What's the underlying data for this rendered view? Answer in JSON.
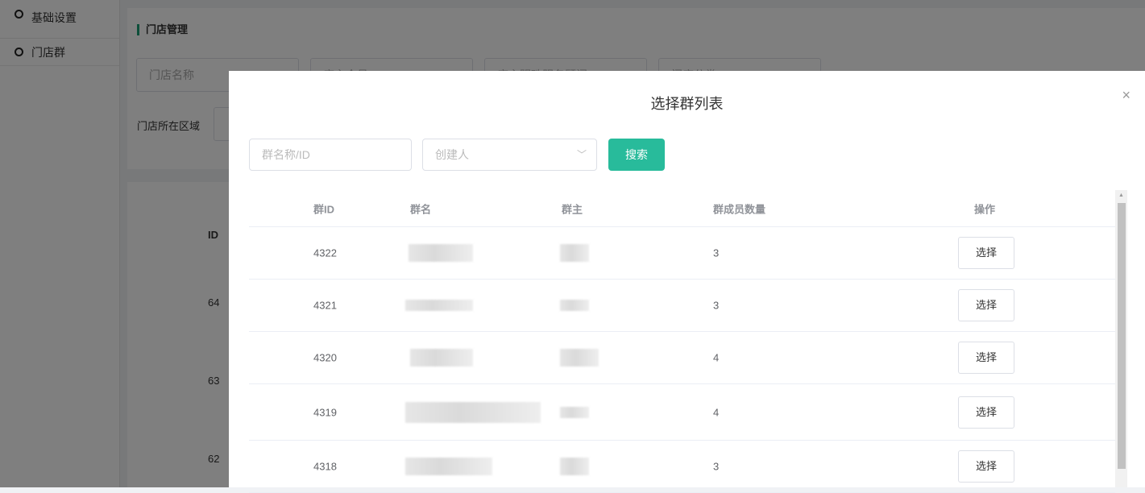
{
  "sidebar": {
    "items": [
      {
        "label": "基础设置"
      },
      {
        "label": "门店群"
      }
    ]
  },
  "page": {
    "title": "门店管理",
    "filters": [
      "门店名称",
      "店主会员ID",
      "店主明珠服务顾问ID",
      "门店分类"
    ],
    "region_label": "门店所在区域",
    "ids": [
      "64",
      "63",
      "62"
    ],
    "id_header": "ID"
  },
  "modal": {
    "title": "选择群列表",
    "close": "×",
    "search_placeholder": "群名称/ID",
    "creator_placeholder": "创建人",
    "search_button": "搜索",
    "columns": [
      "群ID",
      "群名",
      "群主",
      "群成员数量",
      "操作"
    ],
    "rows": [
      {
        "id": "4322",
        "members": "3",
        "action": "选择"
      },
      {
        "id": "4321",
        "members": "3",
        "action": "选择"
      },
      {
        "id": "4320",
        "members": "4",
        "action": "选择"
      },
      {
        "id": "4319",
        "members": "4",
        "action": "选择"
      },
      {
        "id": "4318",
        "members": "3",
        "action": "选择"
      }
    ]
  },
  "colors": {
    "accent": "#28bb9b"
  }
}
